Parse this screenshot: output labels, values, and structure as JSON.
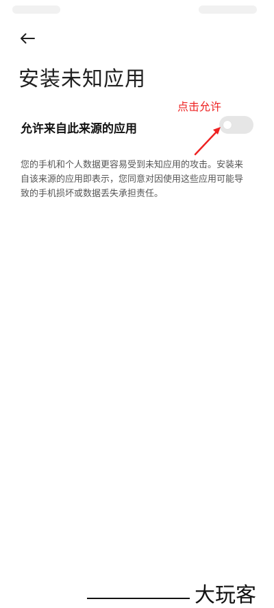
{
  "header": {
    "back_icon": "arrow-left-icon",
    "title": "安装未知应用"
  },
  "setting": {
    "label": "允许来自此来源的应用",
    "toggle_on": false
  },
  "annotation": {
    "text": "点击允许",
    "color": "#ee2222"
  },
  "description": "您的手机和个人数据更容易受到未知应用的攻击。安装来自该来源的应用即表示，您同意对因使用这些应用可能导致的手机损坏或数据丢失承担责任。",
  "watermark": {
    "text": "大玩客"
  },
  "colors": {
    "background": "#ffffff",
    "toggle_off": "#e6e6e6",
    "annotation": "#ee2222"
  }
}
